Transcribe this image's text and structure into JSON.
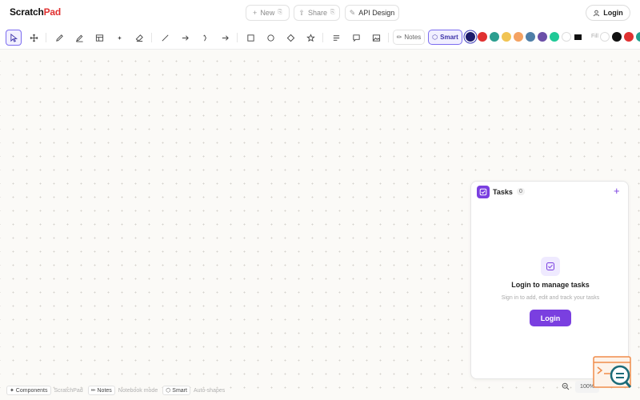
{
  "app": {
    "logo_main": "Scratch",
    "logo_accent": "Pad"
  },
  "header": {
    "new_label": "New",
    "share_label": "Share",
    "doc_title": "API Design",
    "login_label": "Login"
  },
  "toolbar": {
    "tools": [
      "select",
      "pan",
      "pencil",
      "pen",
      "table",
      "add",
      "eraser",
      "line",
      "arrow",
      "curve-arrow",
      "arrow-right",
      "rectangle",
      "circle",
      "diamond",
      "star",
      "text",
      "comment",
      "image"
    ],
    "notes_label": "Notes",
    "smart_label": "Smart",
    "fill_label": "Fill",
    "stroke_colors": [
      "#1d1b6b",
      "#e03131",
      "#2b9e8f",
      "#f1c453",
      "#f4a261",
      "#4f7fa8",
      "#6b4fa8",
      "#20c997",
      "#ffffff"
    ],
    "fill_colors": [
      "#ffffff",
      "#111111",
      "#e03131",
      "#20a090"
    ]
  },
  "tasks": {
    "title": "Tasks",
    "count": "0",
    "add_symbol": "+",
    "empty_title": "Login to manage tasks",
    "empty_subtitle": "Sign in to add, edit and track your tasks",
    "login_label": "Login"
  },
  "bottom": {
    "components_key": "✦ Components",
    "components_desc": "ScratchPad",
    "notes_key": "✏ Notes",
    "notes_desc": "Notebook mode",
    "smart_key": "⬡ Smart",
    "smart_desc": "Auto-shapes",
    "zoom_level": "100%"
  },
  "accent_color": "#7a3fe0"
}
